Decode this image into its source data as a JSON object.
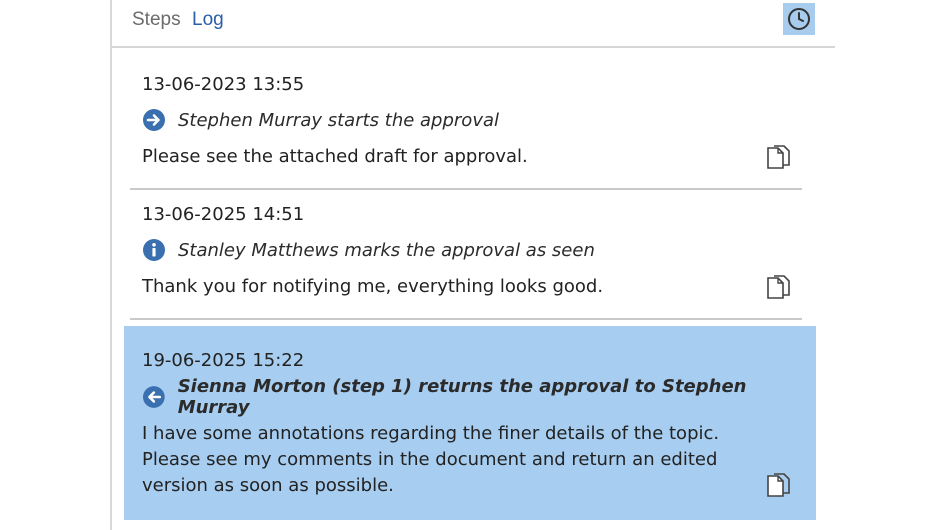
{
  "tabs": {
    "steps_label": "Steps",
    "log_label": "Log"
  },
  "toolbar": {
    "history_icon": "clock-icon"
  },
  "entries": [
    {
      "timestamp": "13-06-2023 13:55",
      "action_icon": "arrow-right-circle-icon",
      "action": "Stephen Murray starts the approval",
      "comment": "Please see the attached draft for approval.",
      "selected": false
    },
    {
      "timestamp": "13-06-2025 14:51",
      "action_icon": "info-circle-icon",
      "action": "Stanley Matthews marks the approval as seen",
      "comment": "Thank you for notifying me, everything looks good.",
      "selected": false
    },
    {
      "timestamp": "19-06-2025 15:22",
      "action_icon": "arrow-left-circle-icon",
      "action": "Sienna Morton (step 1) returns the approval to Stephen Murray",
      "comment": "I have some annotations regarding the finer details of the topic. Please see my comments in the document and return an edited version as soon as possible.",
      "selected": true
    }
  ],
  "colors": {
    "selected_background": "#a7cdf0",
    "icon_blue": "#3a6fb0",
    "tab_active": "#2a5fa6"
  }
}
